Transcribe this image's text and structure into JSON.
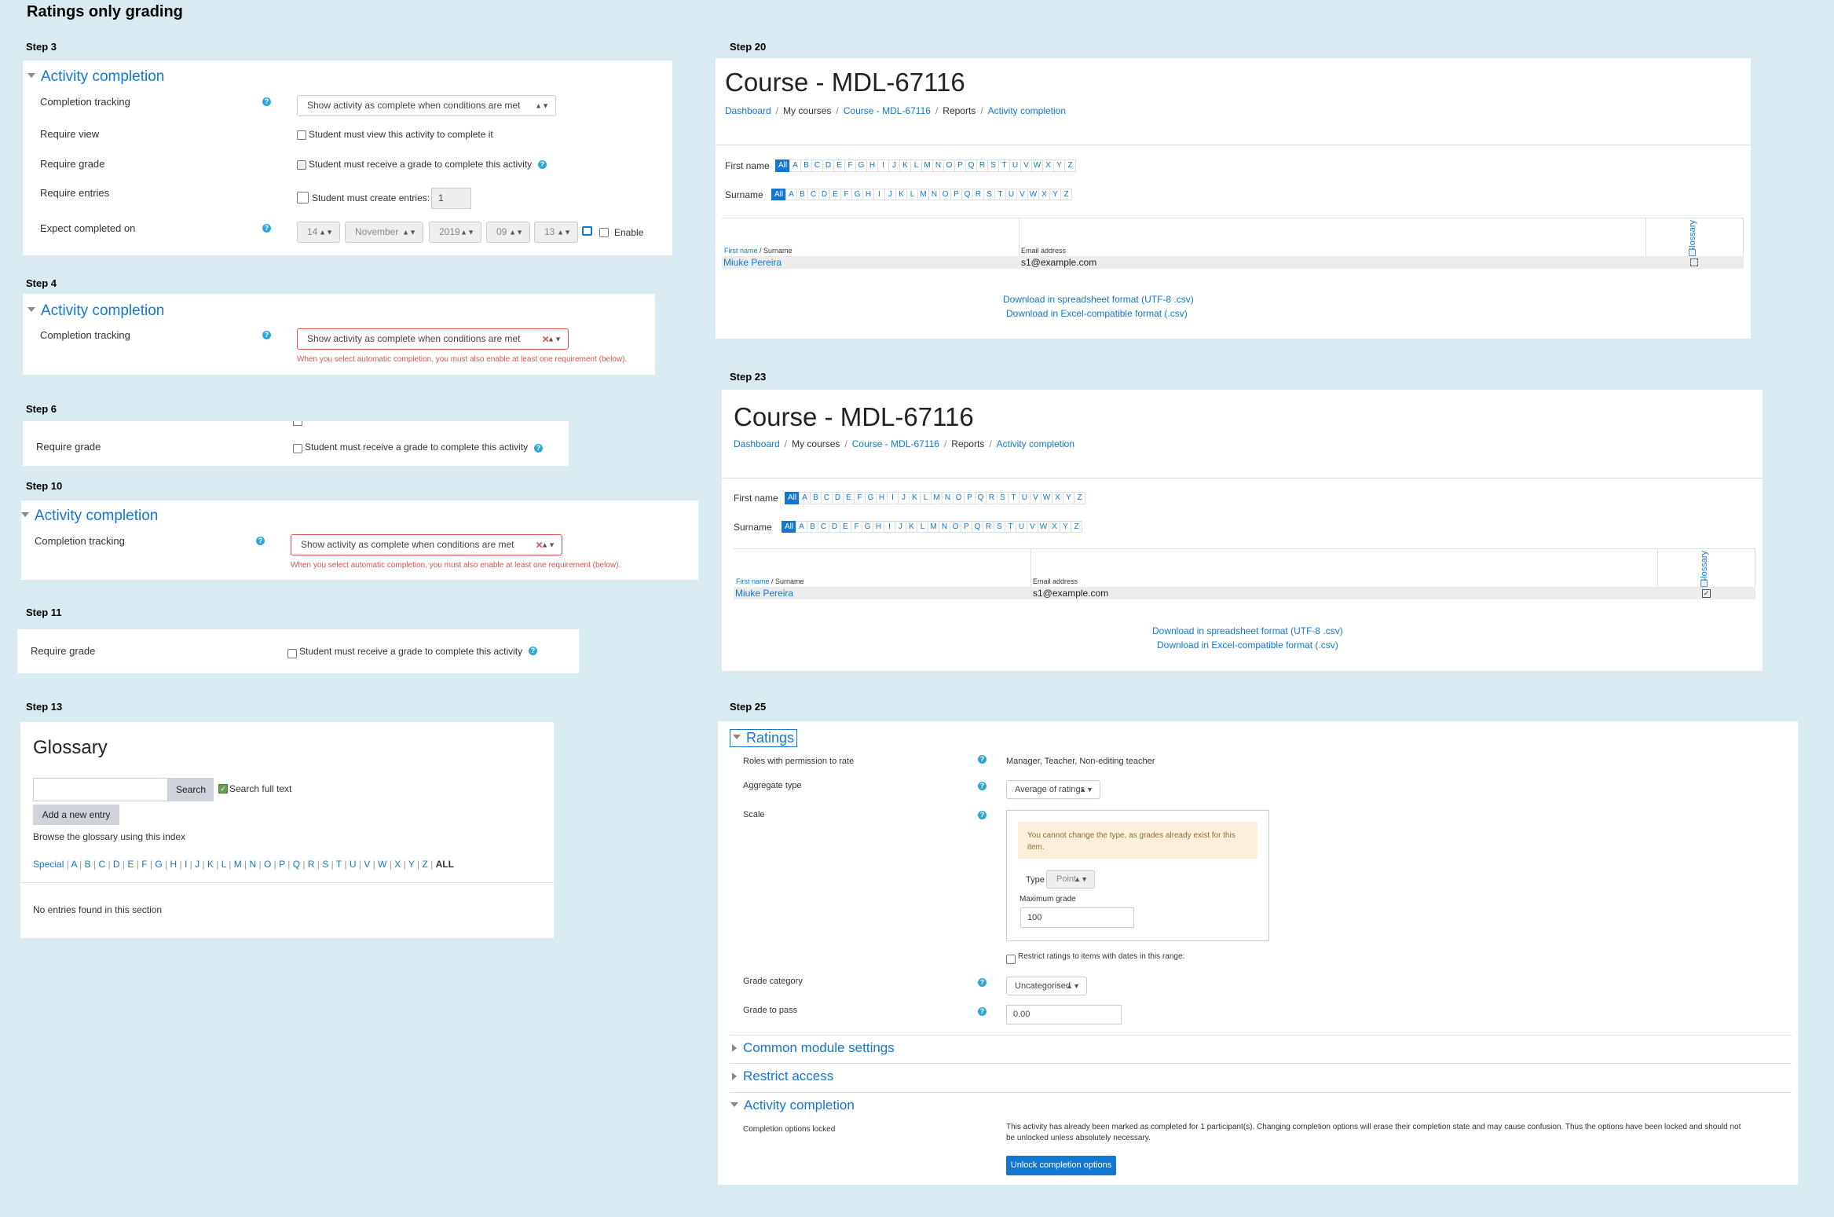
{
  "page_title": "Ratings only grading",
  "steps": {
    "s3": "Step 3",
    "s4": "Step 4",
    "s6": "Step 6",
    "s10": "Step 10",
    "s11": "Step 11",
    "s13": "Step 13",
    "s20": "Step 20",
    "s23": "Step 23",
    "s25": "Step 25"
  },
  "activity_completion": {
    "header": "Activity completion",
    "completion_tracking_label": "Completion tracking",
    "completion_tracking_value": "Show activity as complete when conditions are met",
    "require_view_label": "Require view",
    "require_view_text": "Student must view this activity to complete it",
    "require_grade_label": "Require grade",
    "require_grade_text": "Student must receive a grade to complete this activity",
    "require_entries_label": "Require entries",
    "require_entries_text": "Student must create entries:",
    "require_entries_value": "1",
    "expect_label": "Expect completed on",
    "expect_day": "14",
    "expect_month": "November",
    "expect_year": "2019",
    "expect_hour": "09",
    "expect_minute": "13",
    "enable_label": "Enable",
    "error_text": "When you select automatic completion, you must also enable at least one requirement (below)."
  },
  "glossary": {
    "title": "Glossary",
    "search_button": "Search",
    "search_full_text": "Search full text",
    "add_entry": "Add a new entry",
    "browse_text": "Browse the glossary using this index",
    "index": [
      "Special",
      "A",
      "B",
      "C",
      "D",
      "E",
      "F",
      "G",
      "H",
      "I",
      "J",
      "K",
      "L",
      "M",
      "N",
      "O",
      "P",
      "Q",
      "R",
      "S",
      "T",
      "U",
      "V",
      "W",
      "X",
      "Y",
      "Z"
    ],
    "index_all": "ALL",
    "no_entries": "No entries found in this section"
  },
  "report": {
    "course_title": "Course - MDL-67116",
    "breadcrumb": {
      "dashboard": "Dashboard",
      "my_courses": "My courses",
      "course": "Course - MDL-67116",
      "reports": "Reports",
      "activity_completion": "Activity completion"
    },
    "first_name_label": "First name",
    "surname_label": "Surname",
    "letters": [
      "All",
      "A",
      "B",
      "C",
      "D",
      "E",
      "F",
      "G",
      "H",
      "I",
      "J",
      "K",
      "L",
      "M",
      "N",
      "O",
      "P",
      "Q",
      "R",
      "S",
      "T",
      "U",
      "V",
      "W",
      "X",
      "Y",
      "Z"
    ],
    "col_first_name": "First name",
    "col_slash": " / Surname",
    "col_email": "Email address",
    "col_glossary": "Glossary",
    "student_name": "Miuke Pereira",
    "student_email": "s1@example.com",
    "download_csv": "Download in spreadsheet format (UTF-8 .csv)",
    "download_excel": "Download in Excel-compatible format (.csv)"
  },
  "ratings": {
    "header": "Ratings",
    "roles_label": "Roles with permission to rate",
    "roles_value": "Manager, Teacher, Non-editing teacher",
    "aggregate_label": "Aggregate type",
    "aggregate_value": "Average of ratings",
    "scale_label": "Scale",
    "scale_warning": "You cannot change the type, as grades already exist for this item.",
    "type_label": "Type",
    "type_value": "Point",
    "max_grade_label": "Maximum grade",
    "max_grade_value": "100",
    "restrict_text": "Restrict ratings to items with dates in this range:",
    "grade_category_label": "Grade category",
    "grade_category_value": "Uncategorised",
    "grade_to_pass_label": "Grade to pass",
    "grade_to_pass_value": "0.00",
    "common_module": "Common module settings",
    "restrict_access": "Restrict access",
    "activity_completion": "Activity completion",
    "locked_label": "Completion options locked",
    "locked_text_1": "This activity has already been marked as completed for 1 participant(s). Changing completion options will erase their completion state and may cause confusion. Thus the options have been locked and should not",
    "locked_text_2": "be unlocked unless absolutely necessary.",
    "unlock_button": "Unlock completion options"
  },
  "colors": {
    "link": "#1177d1",
    "error": "#d9534f",
    "background": "#daeaf1"
  }
}
